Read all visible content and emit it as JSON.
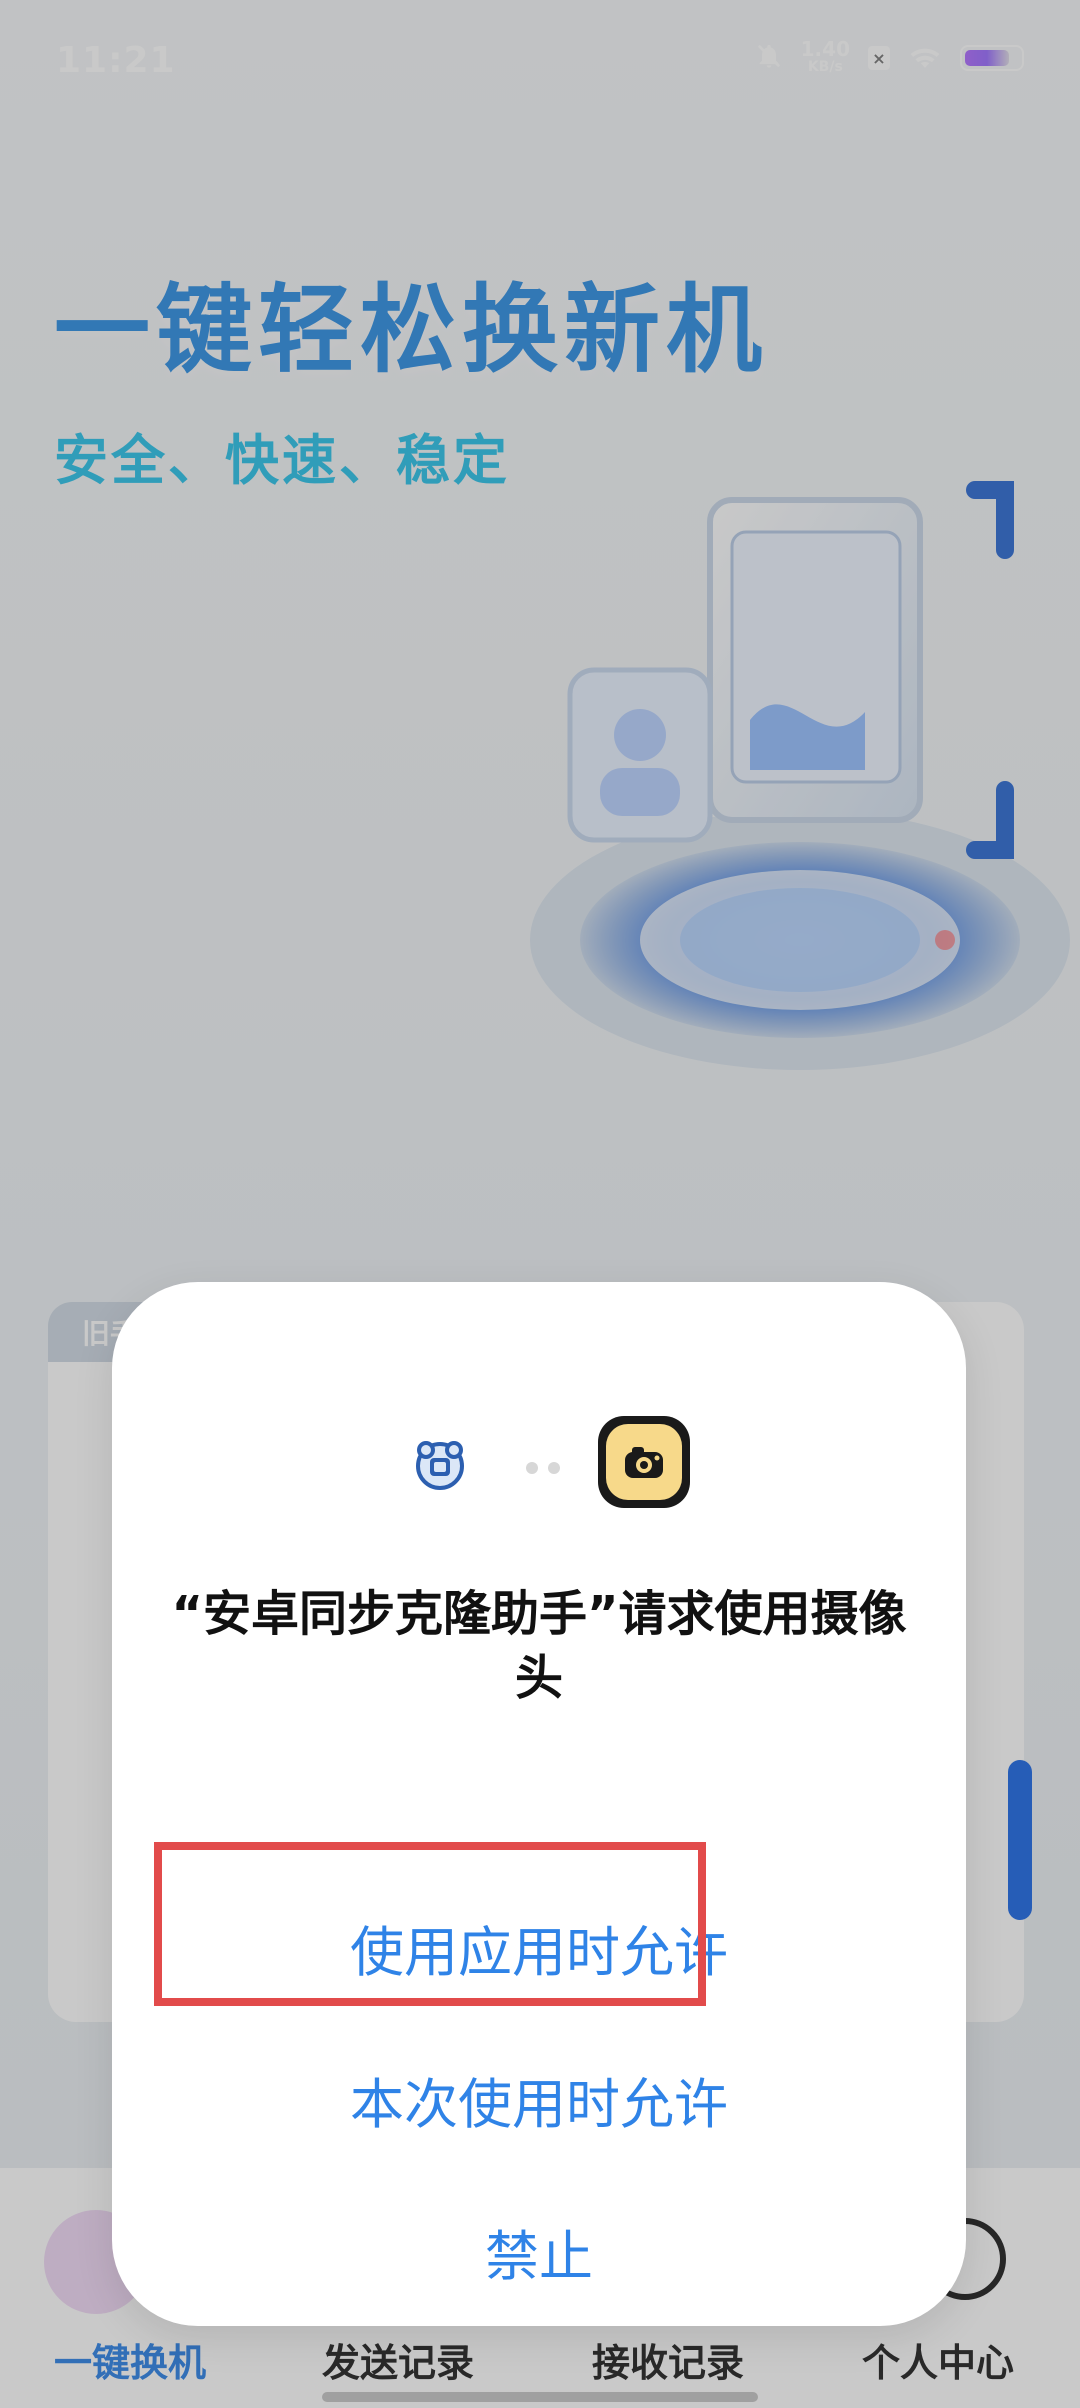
{
  "status_bar": {
    "time": "11:21",
    "network_speed_value": "1.40",
    "network_speed_unit": "KB/s",
    "icons": [
      "bell-muted-icon",
      "sim-x-icon",
      "wifi-icon",
      "battery-icon"
    ]
  },
  "hero": {
    "title": "一键轻松换新机",
    "subtitle": "安全、快速、稳定"
  },
  "background_card": {
    "tab_label": "旧手"
  },
  "bottom_nav": {
    "items": [
      {
        "label": "一键换机",
        "active": true
      },
      {
        "label": "发送记录",
        "active": false
      },
      {
        "label": "接收记录",
        "active": false
      },
      {
        "label": "个人中心",
        "active": false
      }
    ]
  },
  "permission_dialog": {
    "title": "“安卓同步克隆助手”请求使用摄像头",
    "options": [
      "使用应用时允许",
      "本次使用时允许",
      "禁止"
    ]
  },
  "colors": {
    "accent": "#2f83e7",
    "highlight": "#e24b4b"
  }
}
